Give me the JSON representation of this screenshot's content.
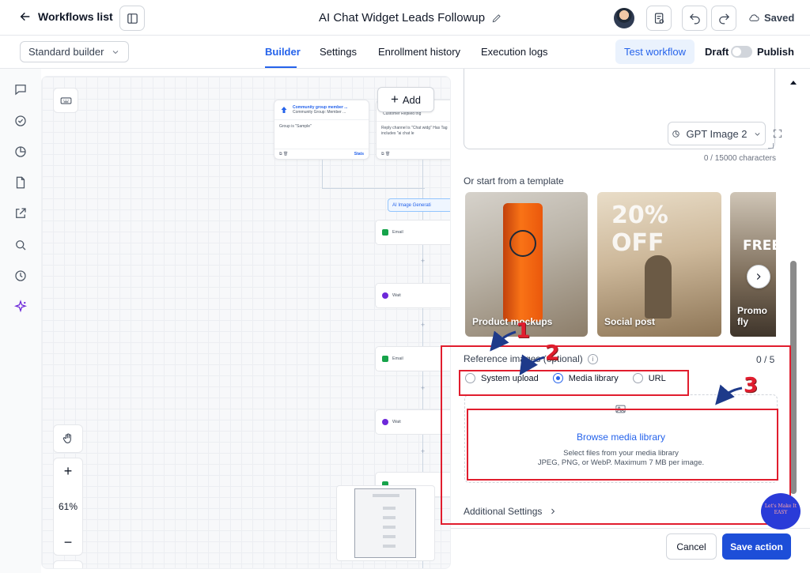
{
  "header": {
    "back_label": "Workflows list",
    "workflow_title": "AI Chat Widget Leads Followup",
    "saved_label": "Saved"
  },
  "subbar": {
    "builder_mode": "Standard builder",
    "tabs": [
      {
        "label": "Builder",
        "active": true
      },
      {
        "label": "Settings",
        "active": false
      },
      {
        "label": "Enrollment history",
        "active": false
      },
      {
        "label": "Execution logs",
        "active": false
      }
    ],
    "test_workflow": "Test workflow",
    "draft_label": "Draft",
    "publish_label": "Publish",
    "published": false
  },
  "rail": {
    "icons": [
      "chat-icon",
      "check-circle-icon",
      "pie-chart-icon",
      "document-icon",
      "external-link-icon",
      "search-icon",
      "history-icon",
      "sparkle-icon"
    ]
  },
  "canvas": {
    "add_label": "Add",
    "trigger_cards": [
      {
        "title": "Community group member ...",
        "subtitle": "Community Group: Member ...",
        "body": "Group is \"Sample\"",
        "footer": "Stats"
      },
      {
        "title": "",
        "subtitle": "Customer Replied trig",
        "body": "Reply channel is \"Chat widg\" Has Tag includes \"ai chat le",
        "footer": ""
      }
    ],
    "ai_chip": "AI Image Generati",
    "nodes": [
      "Email",
      "Wait",
      "Email",
      "Wait"
    ],
    "zoom_level": "61%"
  },
  "panel": {
    "model_select": "GPT Image 2",
    "char_count": "0 / 15000 characters",
    "template_heading": "Or start from a template",
    "templates": [
      {
        "label": "Product mockups"
      },
      {
        "label": "Social post"
      },
      {
        "label": "Promo fly"
      }
    ],
    "reference_label": "Reference images (optional)",
    "reference_count": "0 / 5",
    "source_options": [
      {
        "label": "System upload",
        "selected": false
      },
      {
        "label": "Media library",
        "selected": true
      },
      {
        "label": "URL",
        "selected": false
      }
    ],
    "browse_label": "Browse media library",
    "browse_help_1": "Select files from your media library",
    "browse_help_2": "JPEG, PNG, or WebP. Maximum 7 MB per image.",
    "additional_settings": "Additional Settings",
    "cancel_label": "Cancel",
    "save_label": "Save action"
  },
  "annotations": {
    "markers": [
      "1",
      "2",
      "3"
    ],
    "color": "#e11d2e"
  },
  "watermark": {
    "text": "Let's Make It EASY"
  },
  "colors": {
    "accent": "#2563eb",
    "primary_button": "#1d4ed8"
  }
}
